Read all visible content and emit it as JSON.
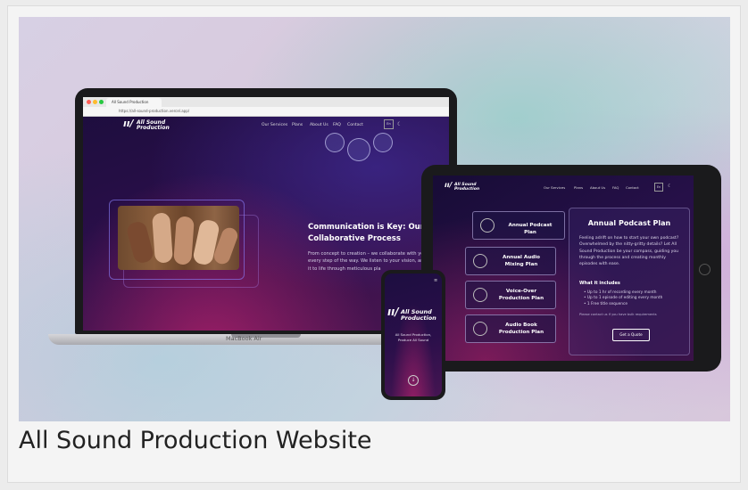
{
  "caption": "All Sound Production Website",
  "laptop": {
    "tab_label": "All Sound Production",
    "url": "https://all-sound-production.vercel.app/",
    "logo_line1": "All Sound",
    "logo_line2": "Production",
    "nav": [
      "Our Services",
      "Plans",
      "About Us",
      "FAQ",
      "Contact"
    ],
    "lang": "En",
    "heading": "Communication is Key: Our Collaborative Process",
    "body": "From concept to creation – we collaborate with you\nevery step of the way. We listen to your vision, and bring\nit to life through meticulous pla",
    "base_label": "MacBook Air"
  },
  "tablet": {
    "logo_line1": "All Sound",
    "logo_line2": "Production",
    "nav": [
      "Our Services",
      "Plans",
      "About Us",
      "FAQ",
      "Contact"
    ],
    "lang": "En",
    "plans": [
      "Annual Podcast Plan",
      "Annual Audio Mixing Plan",
      "Voice-Over Production Plan",
      "Audio Book Production Plan"
    ],
    "detail": {
      "title": "Annual Podcast Plan",
      "body": "Feeling adrift on how to start your own podcast? Overwhelmed by the nitty-gritty details? Let All Sound Production be your compass, guiding you through the process and creating monthly episodes with ease.",
      "includes_heading": "What it includes",
      "includes": [
        "Up to 1 hr of recording every month",
        "Up to 1 episode of editing every month",
        "1 Free title sequence"
      ],
      "note": "Please contact us if you have bulk requirements",
      "button": "Get a Quote"
    }
  },
  "phone": {
    "logo_line1": "All Sound",
    "logo_line2": "Production",
    "tagline": "All Sound Production, Produce All Sound"
  },
  "colors": {
    "brand_dark": "#1c0d3d",
    "accent_pink": "#e6287a"
  }
}
